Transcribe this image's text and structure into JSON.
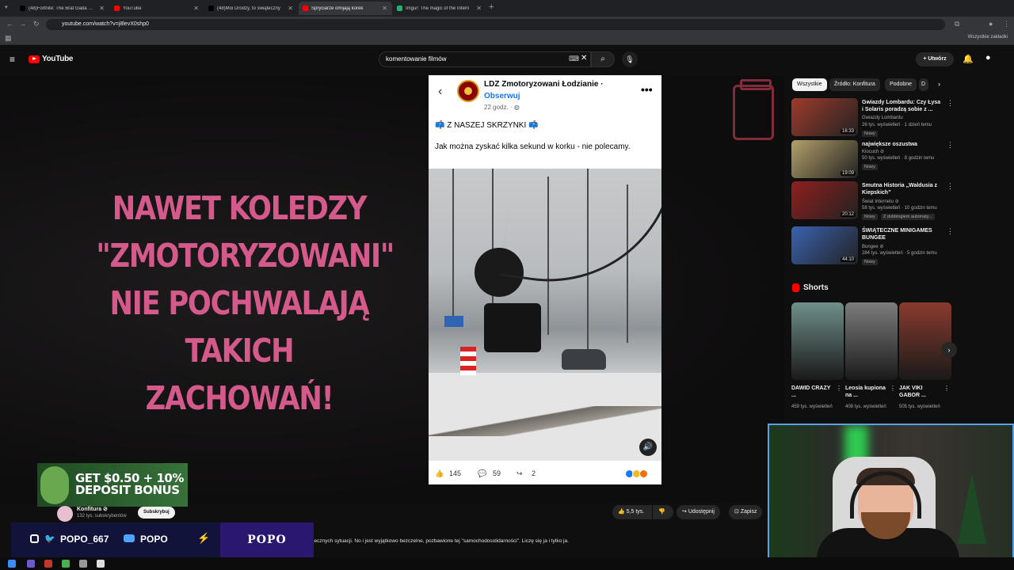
{
  "browser": {
    "tabs": [
      {
        "title": "(48)Fortnite: The Brat Gada Gam",
        "color": "#000000",
        "active": false
      },
      {
        "title": "YouTube",
        "color": "#ff0000",
        "active": false
      },
      {
        "title": "(48)Moi Drodzy, to świąteczny",
        "color": "#000000",
        "active": false
      },
      {
        "title": "Spryciarze omijają korek",
        "color": "#ff0000",
        "active": true
      },
      {
        "title": "Imgur: The magic of the Intern",
        "color": "#1bb76e",
        "active": false
      }
    ],
    "url": "youtube.com/watch?v=j8levX0shp0",
    "bookmarks_label": "Wszystkie zakładki"
  },
  "youtube": {
    "logo": "YouTube",
    "search_value": "komentowanie filmów",
    "create_label": "+ Utwórz"
  },
  "video": {
    "overlay_text": [
      "NAWET KOLEDZY",
      "\"ZMOTORYZOWANI\"",
      "NIE POCHWALAJĄ",
      "TAKICH ZACHOWAŃ!"
    ],
    "post": {
      "page_name": "LDZ Zmotoryzowani Łodzianie ·",
      "follow": "Obserwuj",
      "time": "22 godz. ·",
      "line1": "📫 Z NASZEJ SKRZYNKI 📫",
      "line2": "Jak można zyskać kilka sekund w korku - nie polecamy.",
      "likes": "145",
      "comments": "59",
      "shares": "2"
    }
  },
  "promo": {
    "text_line1": "GET $0.50 + 10%",
    "text_line2": "DEPOSIT BONUS"
  },
  "channel": {
    "name": "Konfitura ⊘",
    "subscribers": "132 tys. subskrybentów",
    "subscribe_label": "Subskrybuj"
  },
  "actions": {
    "likes": "5,5 tys.",
    "share": "Udostępnij",
    "save": "Zapisz"
  },
  "description": "iecznych sytuacji. No i jest wyjątkowo bezczelne, pozbawione tej \"samochodosolidarności\". Liczę się ja i tylko ja.",
  "social": {
    "handle": "POPO_667",
    "yt_name": "POPO",
    "brand": "POPO"
  },
  "sidebar": {
    "chips": [
      "Wszystkie",
      "Źródło: Konfitura",
      "Podobne",
      "D"
    ],
    "recommendations": [
      {
        "title": "Gwiazdy Lombardu: Czy Łysa i Solaris poradzą sobie z ...",
        "channel": "Gwiazdy Lombardu",
        "meta": "26 tys. wyświetleń · 1 dzień temu",
        "badge": "Nowy",
        "duration": "16:33",
        "thumb_color": "#9e3b2c"
      },
      {
        "title": "największe oszustwa",
        "channel": "Klocuch ⊘",
        "meta": "50 tys. wyświetleń · 8 godzin temu",
        "badge": "Nowy",
        "duration": "19:09",
        "thumb_color": "#b4a06a"
      },
      {
        "title": "Smutna Historia „Waldusia z Kiepskich”",
        "channel": "Świat Internetu ⊘",
        "meta": "58 tys. wyświetleń · 10 godzin temu",
        "badge": "Nowy",
        "badge2": "Z dubbingiem automaty...",
        "duration": "20:12",
        "thumb_color": "#8f1f1f"
      },
      {
        "title": "ŚWIĄTECZNE MINIGAMES BUNGEE",
        "channel": "Bungee ⊘",
        "meta": "284 tys. wyświetleń · 5 godzin temu",
        "badge": "Nowy",
        "duration": "44:10",
        "thumb_color": "#3a62b0"
      }
    ],
    "shorts_heading": "Shorts",
    "shorts": [
      {
        "title": "DAWID CRAZY ...",
        "views": "459 tys. wyświetleń",
        "color": "#6f8f8a"
      },
      {
        "title": "Leosia kupiona na ...",
        "views": "408 tys. wyświetleń",
        "color": "#7d7d7d"
      },
      {
        "title": "JAK VIKI GABOR ...",
        "views": "505 tys. wyświetleń",
        "color": "#8a3a2e"
      }
    ]
  }
}
